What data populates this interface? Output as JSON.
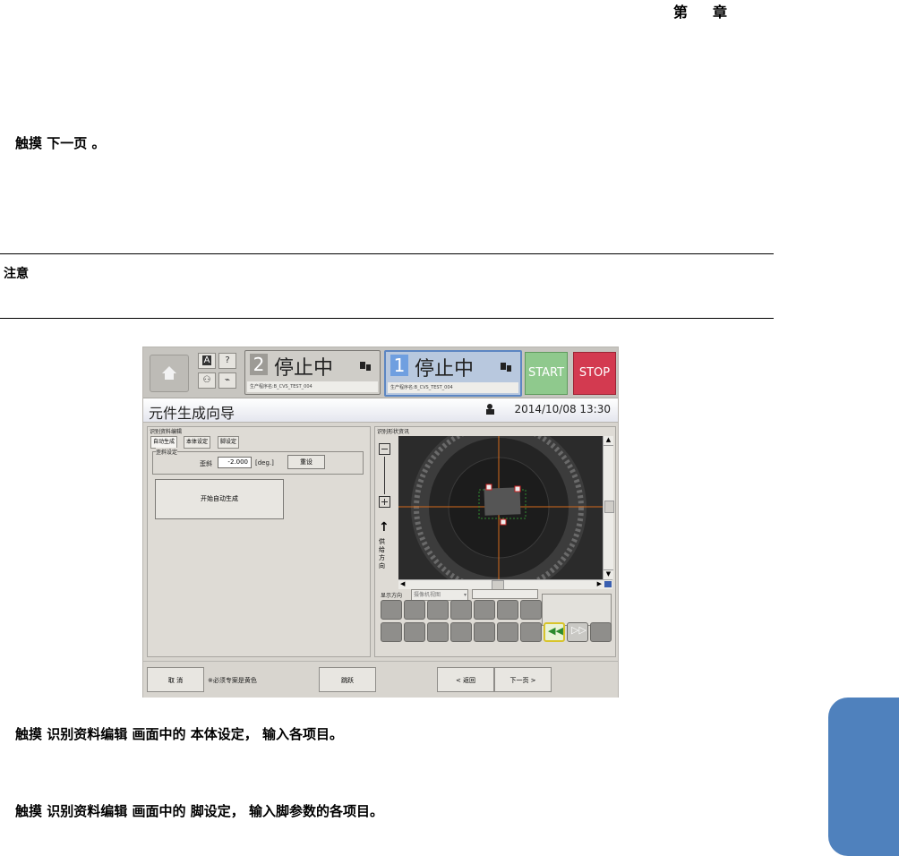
{
  "header": {
    "chapter": "第　章"
  },
  "step_touch_next": {
    "prefix": "触摸",
    "target": "下一页",
    "suffix": "。"
  },
  "note": {
    "label": "注意"
  },
  "screenshot": {
    "topbar": {
      "panel2": {
        "number": "2",
        "state": "停止中",
        "program": "生产程序名:B_CVS_TEST_004"
      },
      "panel1": {
        "number": "1",
        "state": "停止中",
        "program": "生产程序名:B_CVS_TEST_004"
      },
      "start_label": "START",
      "stop_label": "STOP",
      "help_label": "?",
      "font_label": "A"
    },
    "titlebar": {
      "title": "元件生成向导",
      "datetime": "2014/10/08 13:30"
    },
    "left_pane": {
      "title": "识别资料编辑",
      "tabs": [
        "自动生成",
        "本体设定",
        "脚设定"
      ],
      "group_title": "歪斜设定",
      "skew_label": "歪斜",
      "skew_value": "-2.000",
      "skew_unit": "[deg.]",
      "reset_label": "重设",
      "auto_generate_label": "开始自动生成"
    },
    "right_pane": {
      "title": "识别形状资讯",
      "supply_dir_chars": [
        "供",
        "给",
        "方",
        "向"
      ],
      "display_dir_label": "显示方向",
      "display_dir_value": "摄像机视图"
    },
    "bottombar": {
      "cancel_label": "取 消",
      "note_label": "※必须专案是黄色",
      "jump_label": "跳跃",
      "back_label": "< 返回",
      "next_label": "下一页 >"
    }
  },
  "step_body": {
    "prefix": "触摸",
    "target1": "识别资料编辑",
    "middle": "画面中的",
    "target2": "本体设定",
    "suffix": "， 输入各项目。"
  },
  "step_leg": {
    "prefix": "触摸",
    "target1": "识别资料编辑",
    "middle": "画面中的",
    "target2": "脚设定",
    "suffix": "， 输入脚参数的各项目。"
  },
  "colors": {
    "chapter_tab": "#4f81bd",
    "start": "#8fc98d",
    "stop": "#d33a50",
    "active_panel": "#5c86c2"
  }
}
